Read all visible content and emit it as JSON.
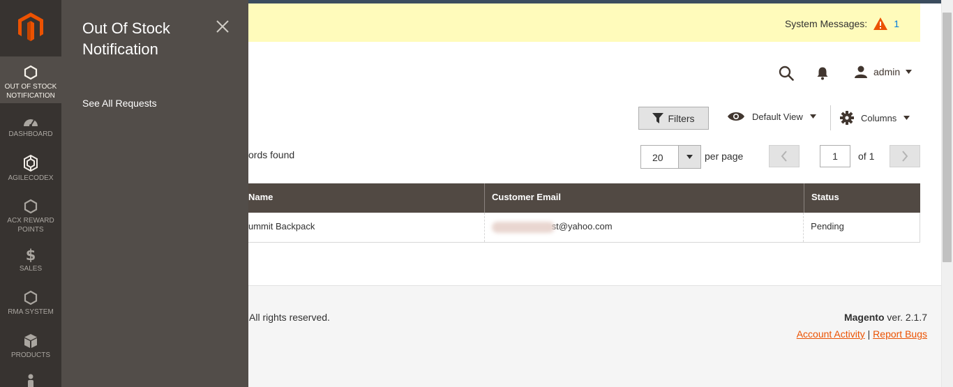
{
  "colors": {
    "nav_bg": "#373330",
    "panel_bg": "#524d49",
    "accent": "#eb5202",
    "message_bar": "#fffbbb",
    "grid_header": "#514943",
    "warning": "#eb5202"
  },
  "nav": {
    "items": [
      {
        "label": "OUT OF STOCK NOTIFICATION",
        "icon": "hexagon-icon",
        "active": true
      },
      {
        "label": "DASHBOARD",
        "icon": "dashboard-icon"
      },
      {
        "label": "AGILECODEX",
        "icon": "agilecodex-icon"
      },
      {
        "label": "ACX REWARD POINTS",
        "icon": "hexagon-icon"
      },
      {
        "label": "SALES",
        "icon": "dollar-icon"
      },
      {
        "label": "RMA SYSTEM",
        "icon": "hexagon-icon"
      },
      {
        "label": "PRODUCTS",
        "icon": "box-icon"
      },
      {
        "label": "",
        "icon": "customer-icon"
      }
    ]
  },
  "panel": {
    "title": "Out Of Stock Notification",
    "link": "See All Requests"
  },
  "system_messages": {
    "label": "System Messages:",
    "count": "1"
  },
  "header": {
    "user": "admin"
  },
  "toolbar": {
    "filters": "Filters",
    "view": "Default View",
    "columns": "Columns"
  },
  "records": {
    "text": "ords found"
  },
  "pager": {
    "per_page_value": "20",
    "per_page_label": "per page",
    "current_page": "1",
    "of_label": "of 1"
  },
  "grid": {
    "columns": [
      "Name",
      "Customer Email",
      "Status"
    ],
    "rows": [
      {
        "name": "ummit Backpack",
        "email": "st@yahoo.com",
        "status": "Pending"
      }
    ]
  },
  "footer": {
    "copyright": "All rights reserved.",
    "brand": "Magento",
    "version": "ver. 2.1.7",
    "separator": "|",
    "link_activity": "Account Activity",
    "link_bugs": "Report Bugs"
  }
}
